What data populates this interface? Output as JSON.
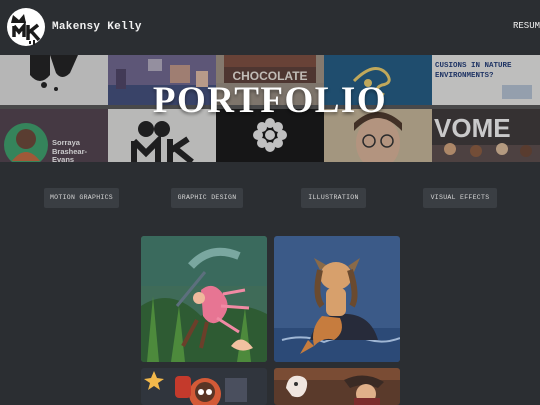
{
  "header": {
    "site_name": "Makensy Kelly",
    "nav_resume": "RESUME"
  },
  "hero": {
    "title": "PORTFOLIO",
    "tiles": {
      "environments_text": "CUSIONS IN NATURE ENVIRONMENTS?",
      "chocolate_text": "CHOCOLATE",
      "person_name": "Sorraya Brashear-Evans",
      "women_text": "VOME"
    }
  },
  "filters": [
    "MOTION GRAPHICS",
    "GRAPHIC DESIGN",
    "ILLUSTRATION",
    "VISUAL EFFECTS"
  ],
  "colors": {
    "background": "#2b2e32",
    "filter_button": "#3a3e43",
    "text": "#e9e9e9"
  }
}
